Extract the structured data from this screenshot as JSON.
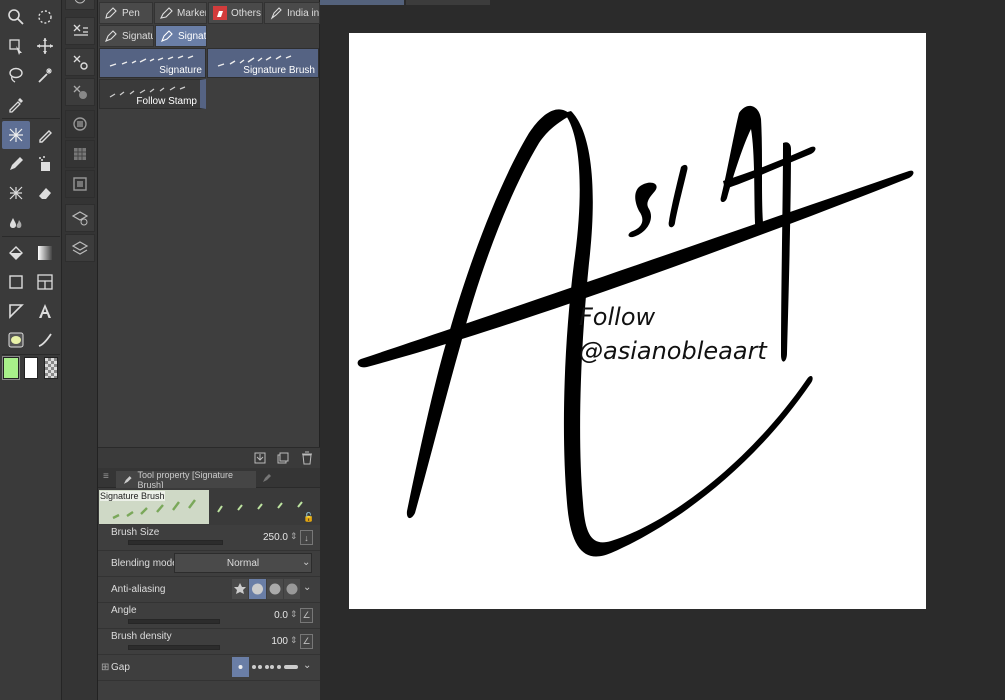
{
  "subtool": {
    "tabs": [
      {
        "label": "Pen",
        "icon": "pen-icon"
      },
      {
        "label": "Marker",
        "icon": "marker-icon"
      },
      {
        "label": "Others",
        "icon": "others-icon"
      },
      {
        "label": "India in",
        "icon": "ink-icon"
      },
      {
        "label": "Signatu",
        "icon": "signature-icon"
      },
      {
        "label": "Signatu",
        "icon": "signature-icon"
      }
    ],
    "brushes": [
      {
        "label": "Signature"
      },
      {
        "label": "Signature Brush"
      },
      {
        "label": "Follow Stamp"
      }
    ]
  },
  "tool_property": {
    "tab_label": "Tool property [Signature Brush]",
    "preview_label": "Signature Brush",
    "brush_size": {
      "label": "Brush Size",
      "value": "250.0"
    },
    "blending_mode": {
      "label": "Blending mode",
      "value": "Normal"
    },
    "anti_aliasing": {
      "label": "Anti-aliasing"
    },
    "angle": {
      "label": "Angle",
      "value": "0.0"
    },
    "brush_density": {
      "label": "Brush density",
      "value": "100"
    },
    "gap": {
      "label": "Gap"
    }
  },
  "canvas": {
    "follow_text": "Follow",
    "handle_text": "@asianobleaart"
  },
  "colors": {
    "main_color": "#a8f08a",
    "sub_color": "#ffffff",
    "selection_accent": "#5e6f94"
  }
}
